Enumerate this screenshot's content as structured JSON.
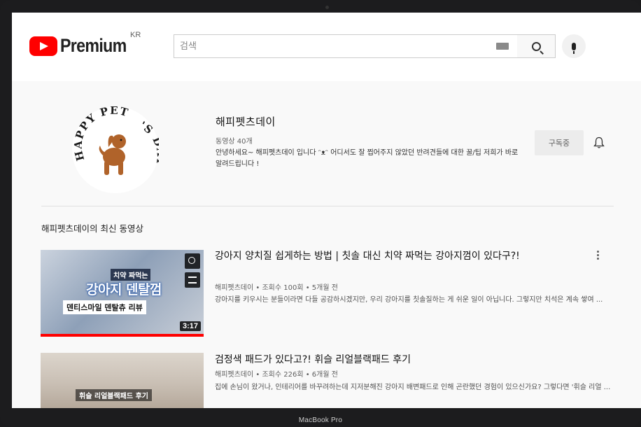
{
  "device": {
    "label": "MacBook Pro"
  },
  "header": {
    "brand": "Premium",
    "region": "KR",
    "search": {
      "placeholder": "검색",
      "value": ""
    }
  },
  "channel": {
    "avatar_text": "HAPPY PET'S DAY",
    "name": "해피펫츠데이",
    "video_count": "동영상 40개",
    "description": "안녕하세요~ 해피펫츠데이 입니다 ᵔᴥᵔ 어디서도 잘 찝어주지 않았던 반려견들에 대한 꿀/팁 저희가 바로 알려드립니다 !",
    "subscribe_label": "구독중"
  },
  "section_title": "해피펫츠데이의 최신 동영상",
  "videos": [
    {
      "title": "강아지 양치질 쉽게하는 방법 | 칫솔 대신 치약 짜먹는 강아지껌이 있다구?!",
      "meta": "해피펫츠데이 • 조회수 100회 • 5개월 전",
      "description": "강아지를 키우시는 분들이라면 다들 공감하시겠지만, 우리 강아지를 칫솔질하는 게 쉬운 일이 아닙니다. 그렇지만 치석은 계속 쌓여 ...",
      "duration": "3:17",
      "overlay_small": "치약 짜먹는",
      "overlay_big": "강아지 덴탈껌",
      "overlay_tag": "덴티스마일 덴탈츄 리뷰",
      "progress_fraction": 1.0
    },
    {
      "title": "검정색 패드가 있다고?! 휘슬 리얼블랙패드 후기",
      "meta": "해피펫츠데이 • 조회수 226회 • 6개월 전",
      "description": "집에 손님이 왔거나, 인테리어를 바꾸려하는데 지저분해진 강아지 배변패드로 인해 곤란했던 경험이 있으신가요? 그렇다면 '휘슬 리얼 ...",
      "overlay": "휘슬 리얼블랙패드 후기"
    }
  ],
  "colors": {
    "brand_red": "#ff0000",
    "avatar_dog": "#b0632a"
  },
  "icons": [
    "keyboard-icon",
    "search-icon",
    "mic-icon",
    "bell-icon",
    "clock-icon",
    "queue-icon",
    "more-vert-icon"
  ]
}
